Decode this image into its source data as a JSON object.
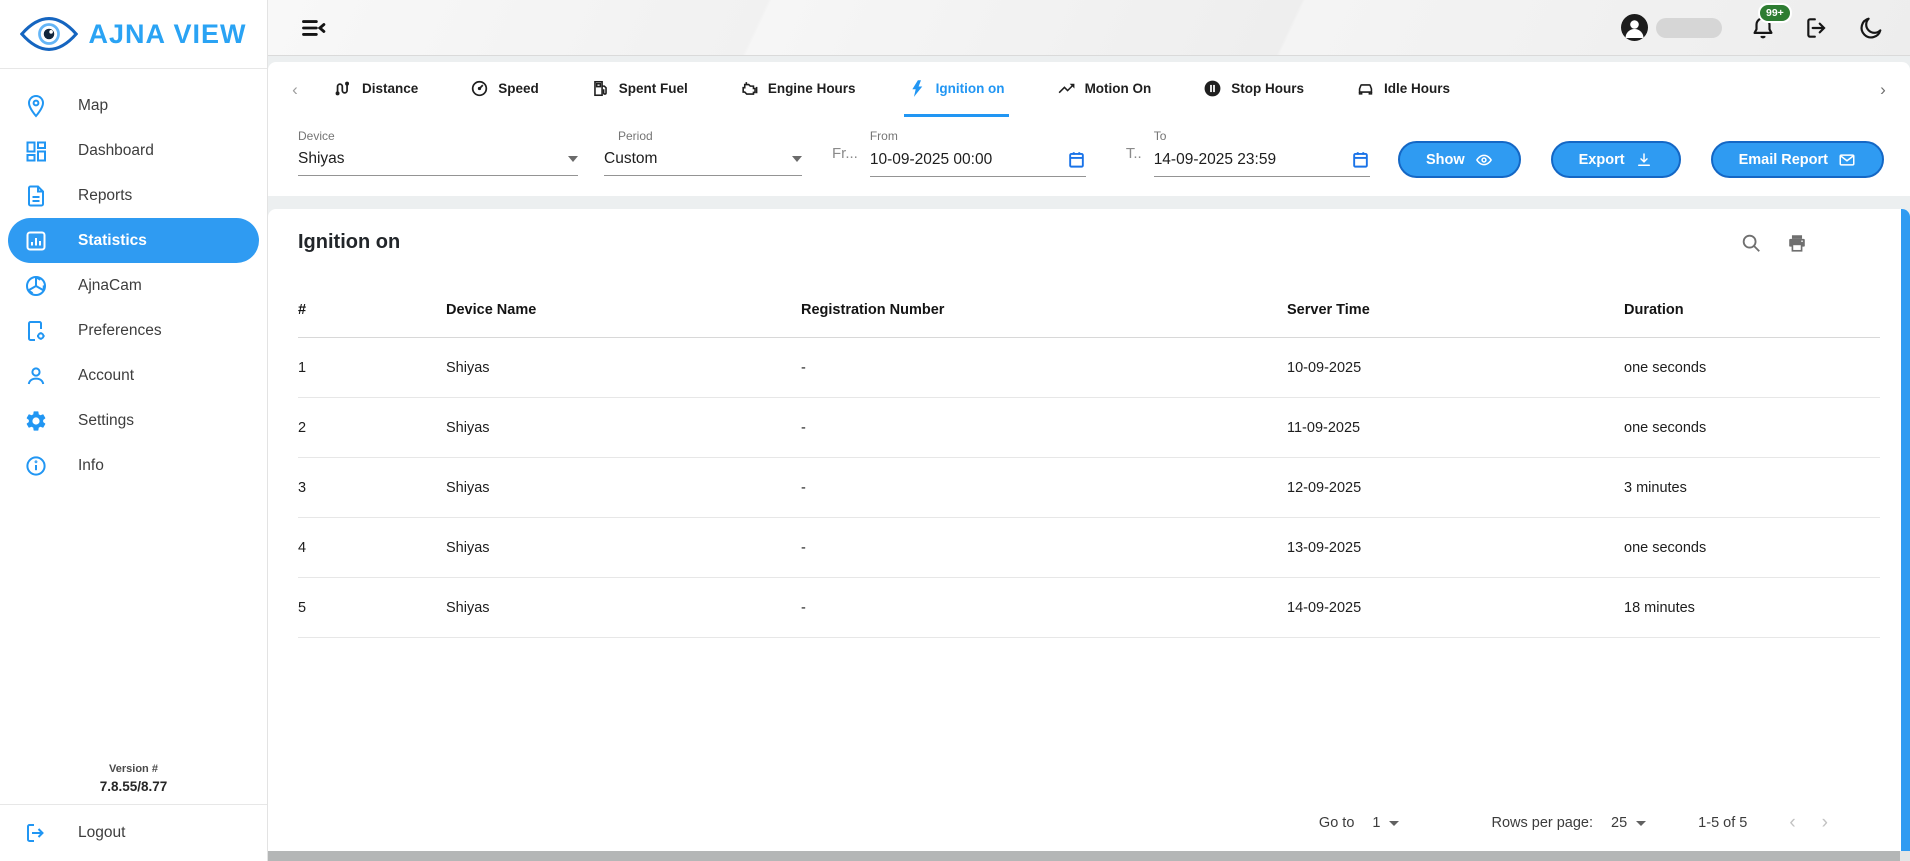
{
  "app": {
    "brand": "AJNA VIEW"
  },
  "topbar": {
    "notification_badge": "99+"
  },
  "colors": {
    "accent": "#2196f3",
    "active_pill": "#2f9bf2",
    "button_border": "#1467c5",
    "badge_green": "#2e7d32",
    "scrollbar_blue": "#2f9bf2"
  },
  "sidebar": {
    "items": [
      {
        "label": "Map",
        "icon": "map-pin-icon",
        "active": false
      },
      {
        "label": "Dashboard",
        "icon": "dashboard-icon",
        "active": false
      },
      {
        "label": "Reports",
        "icon": "reports-icon",
        "active": false
      },
      {
        "label": "Statistics",
        "icon": "statistics-icon",
        "active": true
      },
      {
        "label": "AjnaCam",
        "icon": "camera-aperture-icon",
        "active": false
      },
      {
        "label": "Preferences",
        "icon": "preferences-icon",
        "active": false
      },
      {
        "label": "Account",
        "icon": "account-icon",
        "active": false
      },
      {
        "label": "Settings",
        "icon": "settings-icon",
        "active": false
      },
      {
        "label": "Info",
        "icon": "info-icon",
        "active": false
      }
    ],
    "version_label": "Version #",
    "version_value": "7.8.55/8.77",
    "logout_label": "Logout"
  },
  "tabs": {
    "items": [
      {
        "label": "Distance",
        "icon": "route-icon",
        "active": false
      },
      {
        "label": "Speed",
        "icon": "speedometer-icon",
        "active": false
      },
      {
        "label": "Spent Fuel",
        "icon": "fuel-pump-icon",
        "active": false
      },
      {
        "label": "Engine Hours",
        "icon": "engine-icon",
        "active": false
      },
      {
        "label": "Ignition on",
        "icon": "lightning-icon",
        "active": true
      },
      {
        "label": "Motion On",
        "icon": "trending-up-icon",
        "active": false
      },
      {
        "label": "Stop Hours",
        "icon": "pause-circle-icon",
        "active": false
      },
      {
        "label": "Idle Hours",
        "icon": "car-icon",
        "active": false
      }
    ]
  },
  "filters": {
    "device_label": "Device",
    "device_value": "Shiyas",
    "period_label": "Period",
    "period_value": "Custom",
    "from_overflow": "Fr...",
    "from_label": "From",
    "from_value": "10-09-2025 00:00",
    "to_overflow": "T..",
    "to_label": "To",
    "to_value": "14-09-2025 23:59",
    "show_label": "Show",
    "export_label": "Export",
    "email_label": "Email Report"
  },
  "report": {
    "title": "Ignition on",
    "columns": [
      "#",
      "Device Name",
      "Registration Number",
      "Server Time",
      "Duration"
    ],
    "rows": [
      [
        "1",
        "Shiyas",
        "-",
        "10-09-2025",
        "one seconds"
      ],
      [
        "2",
        "Shiyas",
        "-",
        "11-09-2025",
        "one seconds"
      ],
      [
        "3",
        "Shiyas",
        "-",
        "12-09-2025",
        "3 minutes"
      ],
      [
        "4",
        "Shiyas",
        "-",
        "13-09-2025",
        "one seconds"
      ],
      [
        "5",
        "Shiyas",
        "-",
        "14-09-2025",
        "18 minutes"
      ]
    ],
    "pagination": {
      "goto_label": "Go to",
      "goto_value": "1",
      "rows_per_page_label": "Rows per page:",
      "rows_per_page_value": "25",
      "range": "1-5 of 5",
      "prev": "‹",
      "next": "›"
    }
  }
}
